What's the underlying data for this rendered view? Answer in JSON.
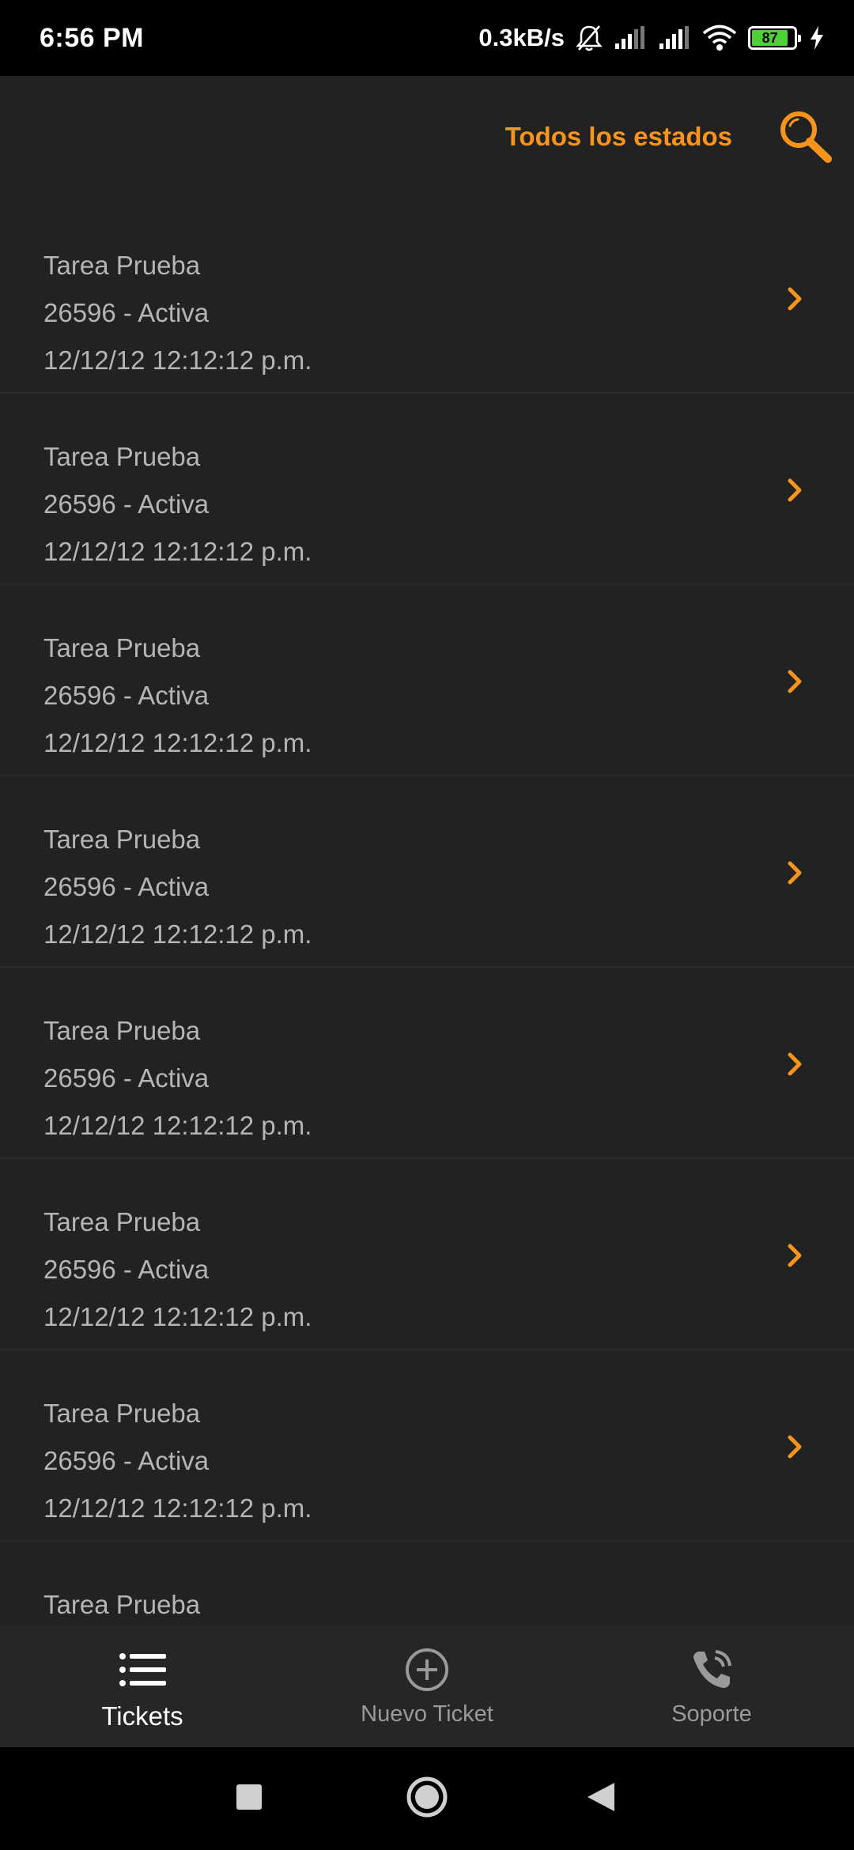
{
  "status_bar": {
    "time": "6:56 PM",
    "net_speed": "0.3kB/s",
    "battery_level": "87",
    "icons": [
      "bell-off-icon",
      "signal-icon",
      "signal-icon",
      "wifi-icon",
      "battery-icon",
      "charging-icon"
    ]
  },
  "header": {
    "filter_label": "Todos los estados",
    "search_icon": "search-icon"
  },
  "tickets": [
    {
      "title": "Tarea Prueba",
      "id_status": "26596 - Activa",
      "datetime": "12/12/12 12:12:12 p.m."
    },
    {
      "title": "Tarea Prueba",
      "id_status": "26596 - Activa",
      "datetime": "12/12/12 12:12:12 p.m."
    },
    {
      "title": "Tarea Prueba",
      "id_status": "26596 - Activa",
      "datetime": "12/12/12 12:12:12 p.m."
    },
    {
      "title": "Tarea Prueba",
      "id_status": "26596 - Activa",
      "datetime": "12/12/12 12:12:12 p.m."
    },
    {
      "title": "Tarea Prueba",
      "id_status": "26596 - Activa",
      "datetime": "12/12/12 12:12:12 p.m."
    },
    {
      "title": "Tarea Prueba",
      "id_status": "26596 - Activa",
      "datetime": "12/12/12 12:12:12 p.m."
    },
    {
      "title": "Tarea Prueba",
      "id_status": "26596 - Activa",
      "datetime": "12/12/12 12:12:12 p.m."
    },
    {
      "title": "Tarea Prueba",
      "id_status": "",
      "datetime": ""
    }
  ],
  "bottom_nav": {
    "tickets_label": "Tickets",
    "new_ticket_label": "Nuevo Ticket",
    "support_label": "Soporte",
    "active": "Tickets"
  },
  "colors": {
    "accent": "#f7941d",
    "background": "#222222",
    "text_secondary": "#b5b5b5"
  }
}
